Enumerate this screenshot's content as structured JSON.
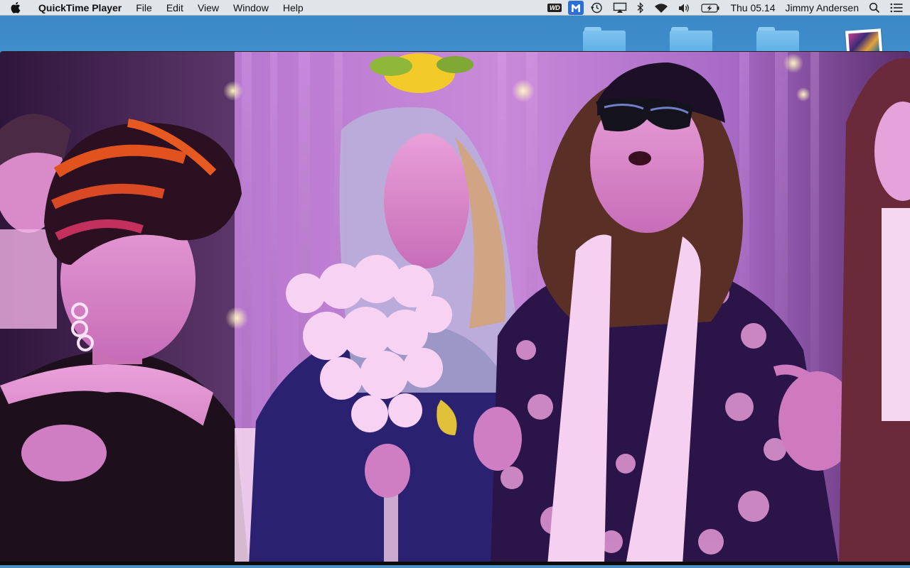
{
  "menubar": {
    "app_name": "QuickTime Player",
    "menus": [
      "File",
      "Edit",
      "View",
      "Window",
      "Help"
    ],
    "status": {
      "wd_label": "WD",
      "malwarebytes_badge": "M",
      "clock": "Thu 05.14",
      "user": "Jimmy Andersen",
      "icons": [
        "wd-drive-icon",
        "malwarebytes-icon",
        "time-machine-icon",
        "airplay-icon",
        "bluetooth-icon",
        "wifi-icon",
        "volume-icon",
        "battery-charging-icon",
        "spotlight-search-icon",
        "notification-center-icon"
      ]
    }
  },
  "desktop": {
    "icons": [
      "folder-icon",
      "folder-icon",
      "folder-icon",
      "photo-icon"
    ]
  },
  "video": {
    "content": "party-video-frame",
    "colors": {
      "background_purple": "#b06ad0",
      "light_pink": "#f4c6ef",
      "magenta": "#d24fb4",
      "dark": "#1a0f28"
    }
  }
}
